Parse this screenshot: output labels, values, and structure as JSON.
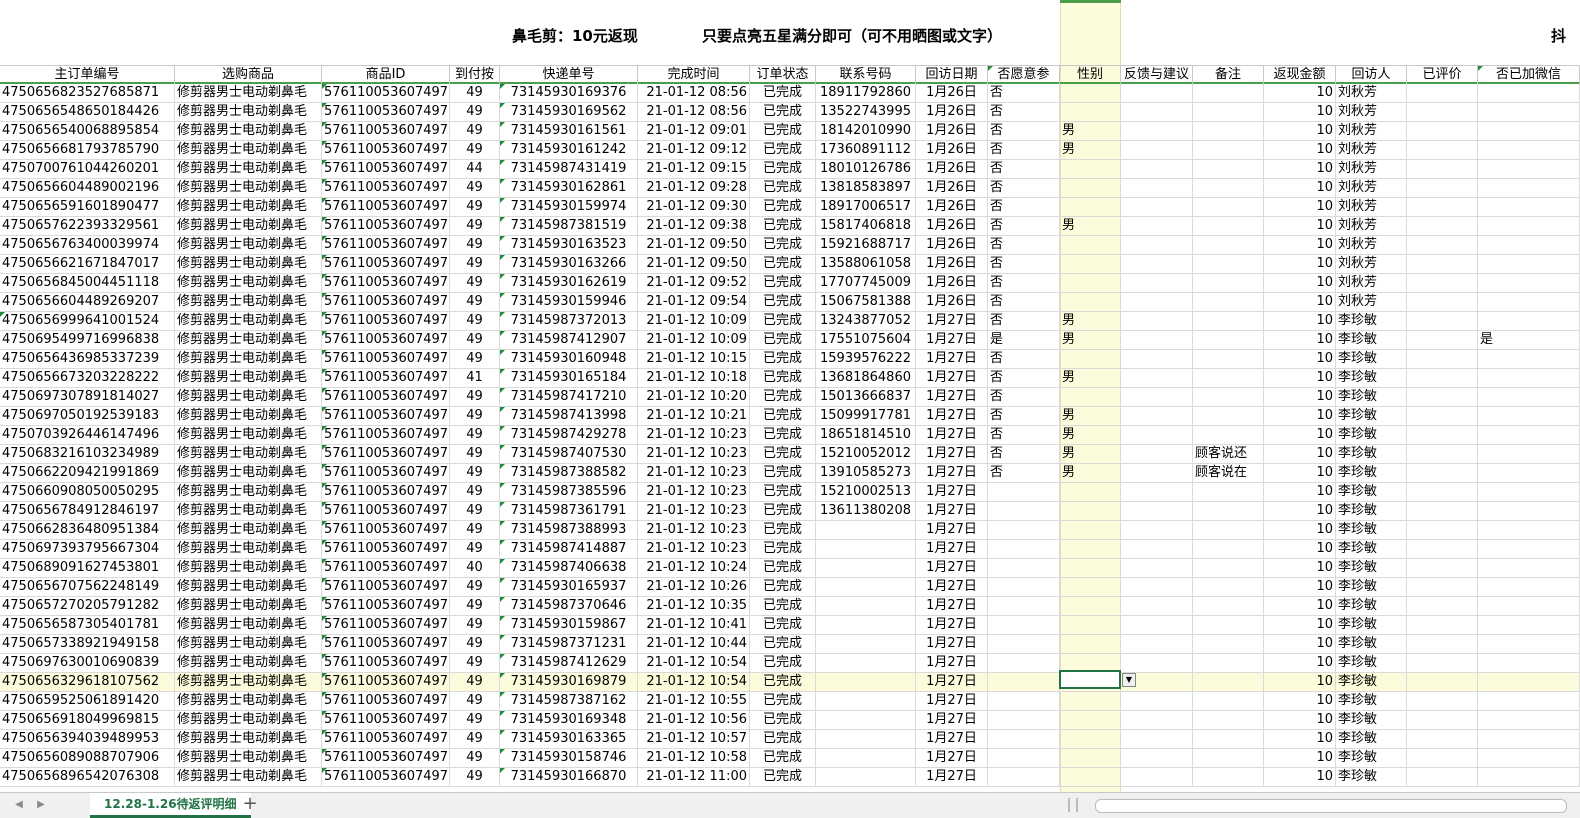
{
  "title": {
    "product": "鼻毛剪：10元返现",
    "condition": "只要点亮五星满分即可（可不用晒图或文字）",
    "edge": "抖"
  },
  "headers": [
    "主订单编号",
    "选购商品",
    "商品ID",
    "到付按",
    "快递单号",
    "完成时间",
    "订单状态",
    "联系号码",
    "回访日期",
    "否愿意参",
    "性别",
    "反馈与建议",
    "备注",
    "返现金额",
    "回访人",
    "已评价",
    "否已加微信"
  ],
  "rows": [
    [
      "4750656823527685871",
      "修剪器男士电动剃鼻毛",
      "576110053607497",
      "49",
      "73145930169376",
      "21-01-12 08:56",
      "已完成",
      "18911792860",
      "1月26日",
      "否",
      "",
      "",
      "",
      "10",
      "刘秋芳",
      "",
      ""
    ],
    [
      "4750656548650184426",
      "修剪器男士电动剃鼻毛",
      "576110053607497",
      "49",
      "73145930169562",
      "21-01-12 08:56",
      "已完成",
      "13522743995",
      "1月26日",
      "否",
      "",
      "",
      "",
      "10",
      "刘秋芳",
      "",
      ""
    ],
    [
      "4750656540068895854",
      "修剪器男士电动剃鼻毛",
      "576110053607497",
      "49",
      "73145930161561",
      "21-01-12 09:01",
      "已完成",
      "18142010990",
      "1月26日",
      "否",
      "男",
      "",
      "",
      "10",
      "刘秋芳",
      "",
      ""
    ],
    [
      "4750656681793785790",
      "修剪器男士电动剃鼻毛",
      "576110053607497",
      "49",
      "73145930161242",
      "21-01-12 09:12",
      "已完成",
      "17360891112",
      "1月26日",
      "否",
      "男",
      "",
      "",
      "10",
      "刘秋芳",
      "",
      ""
    ],
    [
      "4750700761044260201",
      "修剪器男士电动剃鼻毛",
      "576110053607497",
      "44",
      "73145987431419",
      "21-01-12 09:15",
      "已完成",
      "18010126786",
      "1月26日",
      "否",
      "",
      "",
      "",
      "10",
      "刘秋芳",
      "",
      ""
    ],
    [
      "4750656604489002196",
      "修剪器男士电动剃鼻毛",
      "576110053607497",
      "49",
      "73145930162861",
      "21-01-12 09:28",
      "已完成",
      "13818583897",
      "1月26日",
      "否",
      "",
      "",
      "",
      "10",
      "刘秋芳",
      "",
      ""
    ],
    [
      "4750656591601890477",
      "修剪器男士电动剃鼻毛",
      "576110053607497",
      "49",
      "73145930159974",
      "21-01-12 09:30",
      "已完成",
      "18917006517",
      "1月26日",
      "否",
      "",
      "",
      "",
      "10",
      "刘秋芳",
      "",
      ""
    ],
    [
      "4750657622393329561",
      "修剪器男士电动剃鼻毛",
      "576110053607497",
      "49",
      "73145987381519",
      "21-01-12 09:38",
      "已完成",
      "15817406818",
      "1月26日",
      "否",
      "男",
      "",
      "",
      "10",
      "刘秋芳",
      "",
      ""
    ],
    [
      "4750656763400039974",
      "修剪器男士电动剃鼻毛",
      "576110053607497",
      "49",
      "73145930163523",
      "21-01-12 09:50",
      "已完成",
      "15921688717",
      "1月26日",
      "否",
      "",
      "",
      "",
      "10",
      "刘秋芳",
      "",
      ""
    ],
    [
      "4750656621671847017",
      "修剪器男士电动剃鼻毛",
      "576110053607497",
      "49",
      "73145930163266",
      "21-01-12 09:50",
      "已完成",
      "13588061058",
      "1月26日",
      "否",
      "",
      "",
      "",
      "10",
      "刘秋芳",
      "",
      ""
    ],
    [
      "4750656845004451118",
      "修剪器男士电动剃鼻毛",
      "576110053607497",
      "49",
      "73145930162619",
      "21-01-12 09:52",
      "已完成",
      "17707745009",
      "1月26日",
      "否",
      "",
      "",
      "",
      "10",
      "刘秋芳",
      "",
      ""
    ],
    [
      "4750656604489269207",
      "修剪器男士电动剃鼻毛",
      "576110053607497",
      "49",
      "73145930159946",
      "21-01-12 09:54",
      "已完成",
      "15067581388",
      "1月26日",
      "否",
      "",
      "",
      "",
      "10",
      "刘秋芳",
      "",
      ""
    ],
    [
      "4750656999641001524",
      "修剪器男士电动剃鼻毛",
      "576110053607497",
      "49",
      "73145987372013",
      "21-01-12 10:09",
      "已完成",
      "13243877052",
      "1月27日",
      "否",
      "男",
      "",
      "",
      "10",
      "李珍敏",
      "",
      ""
    ],
    [
      "4750695499716996838",
      "修剪器男士电动剃鼻毛",
      "576110053607497",
      "49",
      "73145987412907",
      "21-01-12 10:09",
      "已完成",
      "17551075604",
      "1月27日",
      "是",
      "男",
      "",
      "",
      "10",
      "李珍敏",
      "",
      "是"
    ],
    [
      "4750656436985337239",
      "修剪器男士电动剃鼻毛",
      "576110053607497",
      "49",
      "73145930160948",
      "21-01-12 10:15",
      "已完成",
      "15939576222",
      "1月27日",
      "否",
      "",
      "",
      "",
      "10",
      "李珍敏",
      "",
      ""
    ],
    [
      "4750656673203228222",
      "修剪器男士电动剃鼻毛",
      "576110053607497",
      "41",
      "73145930165184",
      "21-01-12 10:18",
      "已完成",
      "13681864860",
      "1月27日",
      "否",
      "男",
      "",
      "",
      "10",
      "李珍敏",
      "",
      ""
    ],
    [
      "4750697307891814027",
      "修剪器男士电动剃鼻毛",
      "576110053607497",
      "49",
      "73145987417210",
      "21-01-12 10:20",
      "已完成",
      "15013666837",
      "1月27日",
      "否",
      "",
      "",
      "",
      "10",
      "李珍敏",
      "",
      ""
    ],
    [
      "4750697050192539183",
      "修剪器男士电动剃鼻毛",
      "576110053607497",
      "49",
      "73145987413998",
      "21-01-12 10:21",
      "已完成",
      "15099917781",
      "1月27日",
      "否",
      "男",
      "",
      "",
      "10",
      "李珍敏",
      "",
      ""
    ],
    [
      "4750703926446147496",
      "修剪器男士电动剃鼻毛",
      "576110053607497",
      "49",
      "73145987429278",
      "21-01-12 10:23",
      "已完成",
      "18651814510",
      "1月27日",
      "否",
      "男",
      "",
      "",
      "10",
      "李珍敏",
      "",
      ""
    ],
    [
      "4750683216103234989",
      "修剪器男士电动剃鼻毛",
      "576110053607497",
      "49",
      "73145987407530",
      "21-01-12 10:23",
      "已完成",
      "15210052012",
      "1月27日",
      "否",
      "男",
      "",
      "顾客说还",
      "10",
      "李珍敏",
      "",
      ""
    ],
    [
      "4750662209421991869",
      "修剪器男士电动剃鼻毛",
      "576110053607497",
      "49",
      "73145987388582",
      "21-01-12 10:23",
      "已完成",
      "13910585273",
      "1月27日",
      "否",
      "男",
      "",
      "顾客说在",
      "10",
      "李珍敏",
      "",
      ""
    ],
    [
      "4750660908050050295",
      "修剪器男士电动剃鼻毛",
      "576110053607497",
      "49",
      "73145987385596",
      "21-01-12 10:23",
      "已完成",
      "15210002513",
      "1月27日",
      "",
      "",
      "",
      "",
      "10",
      "李珍敏",
      "",
      ""
    ],
    [
      "4750656784912846197",
      "修剪器男士电动剃鼻毛",
      "576110053607497",
      "49",
      "73145987361791",
      "21-01-12 10:23",
      "已完成",
      "13611380208",
      "1月27日",
      "",
      "",
      "",
      "",
      "10",
      "李珍敏",
      "",
      ""
    ],
    [
      "4750662836480951384",
      "修剪器男士电动剃鼻毛",
      "576110053607497",
      "49",
      "73145987388993",
      "21-01-12 10:23",
      "已完成",
      "",
      "1月27日",
      "",
      "",
      "",
      "",
      "10",
      "李珍敏",
      "",
      ""
    ],
    [
      "4750697393795667304",
      "修剪器男士电动剃鼻毛",
      "576110053607497",
      "49",
      "73145987414887",
      "21-01-12 10:23",
      "已完成",
      "",
      "1月27日",
      "",
      "",
      "",
      "",
      "10",
      "李珍敏",
      "",
      ""
    ],
    [
      "4750689091627453801",
      "修剪器男士电动剃鼻毛",
      "576110053607497",
      "40",
      "73145987406638",
      "21-01-12 10:24",
      "已完成",
      "",
      "1月27日",
      "",
      "",
      "",
      "",
      "10",
      "李珍敏",
      "",
      ""
    ],
    [
      "4750656707562248149",
      "修剪器男士电动剃鼻毛",
      "576110053607497",
      "49",
      "73145930165937",
      "21-01-12 10:26",
      "已完成",
      "",
      "1月27日",
      "",
      "",
      "",
      "",
      "10",
      "李珍敏",
      "",
      ""
    ],
    [
      "4750657270205791282",
      "修剪器男士电动剃鼻毛",
      "576110053607497",
      "49",
      "73145987370646",
      "21-01-12 10:35",
      "已完成",
      "",
      "1月27日",
      "",
      "",
      "",
      "",
      "10",
      "李珍敏",
      "",
      ""
    ],
    [
      "4750656587305401781",
      "修剪器男士电动剃鼻毛",
      "576110053607497",
      "49",
      "73145930159867",
      "21-01-12 10:41",
      "已完成",
      "",
      "1月27日",
      "",
      "",
      "",
      "",
      "10",
      "李珍敏",
      "",
      ""
    ],
    [
      "4750657338921949158",
      "修剪器男士电动剃鼻毛",
      "576110053607497",
      "49",
      "73145987371231",
      "21-01-12 10:44",
      "已完成",
      "",
      "1月27日",
      "",
      "",
      "",
      "",
      "10",
      "李珍敏",
      "",
      ""
    ],
    [
      "4750697630010690839",
      "修剪器男士电动剃鼻毛",
      "576110053607497",
      "49",
      "73145987412629",
      "21-01-12 10:54",
      "已完成",
      "",
      "1月27日",
      "",
      "",
      "",
      "",
      "10",
      "李珍敏",
      "",
      ""
    ],
    [
      "4750656329618107562",
      "修剪器男士电动剃鼻毛",
      "576110053607497",
      "49",
      "73145930169879",
      "21-01-12 10:54",
      "已完成",
      "",
      "1月27日",
      "",
      "",
      "",
      "",
      "10",
      "李珍敏",
      "",
      ""
    ],
    [
      "4750659525061891420",
      "修剪器男士电动剃鼻毛",
      "576110053607497",
      "49",
      "73145987387162",
      "21-01-12 10:55",
      "已完成",
      "",
      "1月27日",
      "",
      "",
      "",
      "",
      "10",
      "李珍敏",
      "",
      ""
    ],
    [
      "4750656918049969815",
      "修剪器男士电动剃鼻毛",
      "576110053607497",
      "49",
      "73145930169348",
      "21-01-12 10:56",
      "已完成",
      "",
      "1月27日",
      "",
      "",
      "",
      "",
      "10",
      "李珍敏",
      "",
      ""
    ],
    [
      "4750656394039489953",
      "修剪器男士电动剃鼻毛",
      "576110053607497",
      "49",
      "73145930163365",
      "21-01-12 10:57",
      "已完成",
      "",
      "1月27日",
      "",
      "",
      "",
      "",
      "10",
      "李珍敏",
      "",
      ""
    ],
    [
      "4750656089088707906",
      "修剪器男士电动剃鼻毛",
      "576110053607497",
      "49",
      "73145930158746",
      "21-01-12 10:58",
      "已完成",
      "",
      "1月27日",
      "",
      "",
      "",
      "",
      "10",
      "李珍敏",
      "",
      ""
    ],
    [
      "4750656896542076308",
      "修剪器男士电动剃鼻毛",
      "576110053607497",
      "49",
      "73145930166870",
      "21-01-12 11:00",
      "已完成",
      "",
      "1月27日",
      "",
      "",
      "",
      "",
      "10",
      "李珍敏",
      "",
      ""
    ]
  ],
  "selected_row": 31,
  "sheet_tab": "12.28-1.26待返评明细",
  "add_sheet_symbol": "+",
  "icons": {
    "dropdown": "chevron-down-icon",
    "prev": "triangle-left-icon",
    "next": "triangle-right-icon"
  },
  "colors": {
    "accent": "#217346",
    "header_line": "#4a9e4a",
    "highlight": "#fcfcdc",
    "grid": "#dadada"
  }
}
